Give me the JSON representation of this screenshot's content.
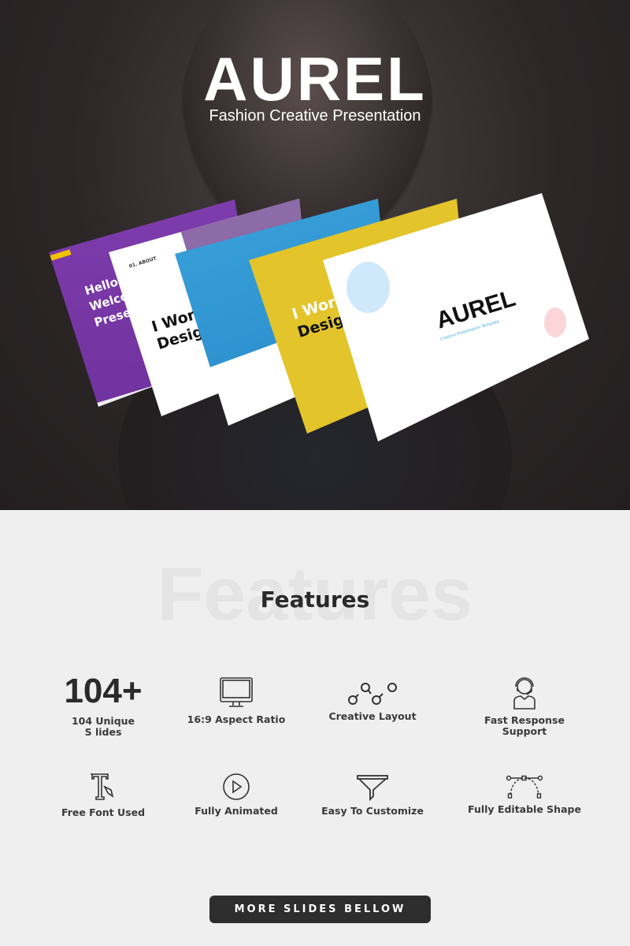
{
  "hero": {
    "title": "AUREL",
    "subtitle": "Fashion Creative Presentation",
    "slides": {
      "purple_lines": [
        "Hello I'",
        "Welcom",
        "Presen"
      ],
      "about_label": "01. ABOUT",
      "work_line1": "I Work",
      "work_line2": "Desig",
      "logo": "AUREL",
      "logo_tagline": "Creative Presentation Template"
    }
  },
  "features": {
    "background_word": "Features",
    "title": "Features",
    "items": [
      {
        "label": "104 Unique S lides",
        "headline": "104+",
        "icon": "none"
      },
      {
        "label": "16:9 Aspect Ratio",
        "icon": "monitor-icon"
      },
      {
        "label": "Creative Layout",
        "icon": "nodes-icon"
      },
      {
        "label": "Fast Response Support",
        "icon": "support-agent-icon"
      },
      {
        "label": "Free Font Used",
        "icon": "font-pen-icon"
      },
      {
        "label": "Fully Animated",
        "icon": "play-circle-icon"
      },
      {
        "label": "Easy To Customize",
        "icon": "funnel-icon"
      },
      {
        "label": "Fully Editable Shape",
        "icon": "bezier-curve-icon"
      }
    ]
  },
  "cta": {
    "label": "MORE SLIDES BELLOW"
  },
  "colors": {
    "purple": "#7a3aa8",
    "blue": "#3aa7e0",
    "teal": "#6fd0c8",
    "yellow": "#e6c22a",
    "red": "#e04a4a",
    "dark": "#2e2e2e"
  }
}
